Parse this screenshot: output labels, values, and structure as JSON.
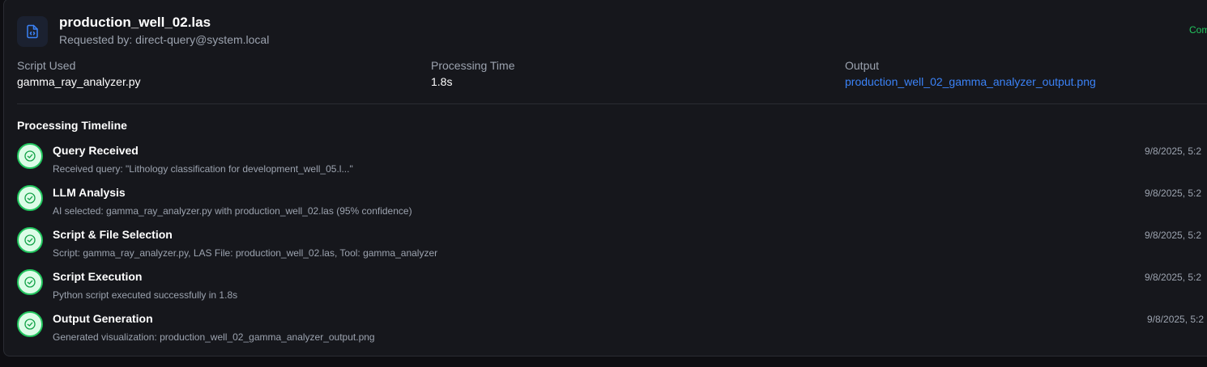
{
  "header": {
    "title": "production_well_02.las",
    "requested_by": "Requested by: direct-query@system.local",
    "status": "Com",
    "icon": "file-code-icon"
  },
  "meta": {
    "script_label": "Script Used",
    "script_value": "gamma_ray_analyzer.py",
    "time_label": "Processing Time",
    "time_value": "1.8s",
    "output_label": "Output",
    "output_value": "production_well_02_gamma_analyzer_output.png"
  },
  "timeline": {
    "heading": "Processing Timeline",
    "steps": [
      {
        "title": "Query Received",
        "desc": "Received query: \"Lithology classification for development_well_05.l...\"",
        "time": "9/8/2025, 5:2"
      },
      {
        "title": "LLM Analysis",
        "desc": "AI selected: gamma_ray_analyzer.py with production_well_02.las (95% confidence)",
        "time": "9/8/2025, 5:2"
      },
      {
        "title": "Script & File Selection",
        "desc": "Script: gamma_ray_analyzer.py, LAS File: production_well_02.las, Tool: gamma_analyzer",
        "time": "9/8/2025, 5:2"
      },
      {
        "title": "Script Execution",
        "desc": "Python script executed successfully in 1.8s",
        "time": "9/8/2025, 5:2"
      },
      {
        "title": "Output Generation",
        "desc": "Generated visualization: production_well_02_gamma_analyzer_output.png",
        "time": "9/8/2025, 5:2"
      }
    ]
  },
  "colors": {
    "accent_link": "#3b82f6",
    "success": "#22c55e",
    "background": "#16171c"
  }
}
